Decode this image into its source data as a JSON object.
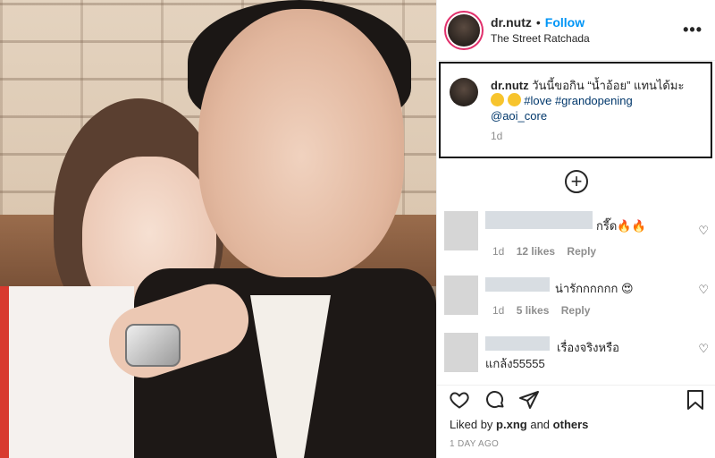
{
  "header": {
    "username": "dr.nutz",
    "dot": "•",
    "follow_label": "Follow",
    "location": "The Street Ratchada",
    "more_glyph": "•••"
  },
  "caption": {
    "username": "dr.nutz",
    "line1": "วันนี้ขอกิน “น้ำอ้อย” แทนได้มะ",
    "hashtags": "#love #grandopening",
    "mention": "@aoi_core",
    "time": "1d"
  },
  "comments": [
    {
      "text": "กรี๊ด🔥🔥",
      "time": "1d",
      "likes": "12 likes",
      "reply": "Reply"
    },
    {
      "text": "น่ารักกกกกก 😍",
      "time": "1d",
      "likes": "5 likes",
      "reply": "Reply"
    },
    {
      "text": "เรื่องจริงหรือ",
      "text2": "แกล้ง55555"
    }
  ],
  "liked_by": {
    "prefix": "Liked by",
    "user": "p.xng",
    "and": "and",
    "others": "others"
  },
  "timestamp": "1 DAY AGO",
  "colors": {
    "follow": "#0095f6",
    "hashtag": "#00376b",
    "meta": "#8e8e8e"
  }
}
